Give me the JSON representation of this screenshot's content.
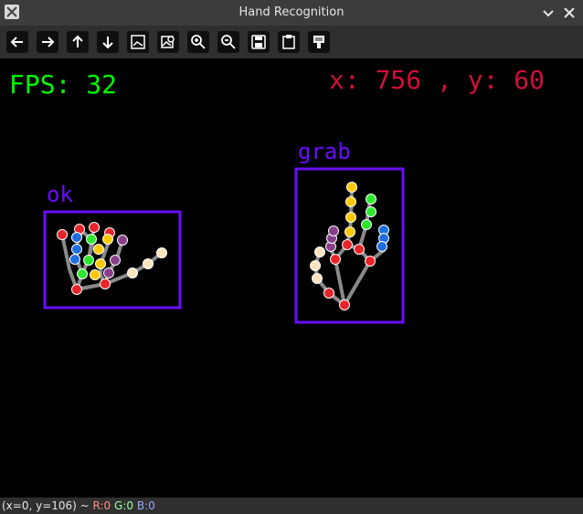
{
  "window": {
    "title": "Hand Recognition"
  },
  "overlay": {
    "fps_text": "FPS: 32",
    "coords_text": "x: 756 , y: 60",
    "colors": {
      "fps": "#00ff00",
      "coords": "#d0103a",
      "box": "#6a0dff",
      "skeleton": "#8a8a8a"
    }
  },
  "hands": [
    {
      "label": "ok"
    },
    {
      "label": "grab"
    }
  ],
  "status": {
    "prefix": "(x=0, y=106) ~",
    "r": "R:0",
    "g": "G:0",
    "b": "B:0"
  },
  "toolbar_icons": [
    "arrow-left-icon",
    "arrow-right-icon",
    "arrow-up-icon",
    "arrow-down-icon",
    "zoom-fit-icon",
    "image-zoom-icon",
    "zoom-in-icon",
    "zoom-out-icon",
    "save-icon",
    "copy-clipboard-icon",
    "properties-icon"
  ]
}
